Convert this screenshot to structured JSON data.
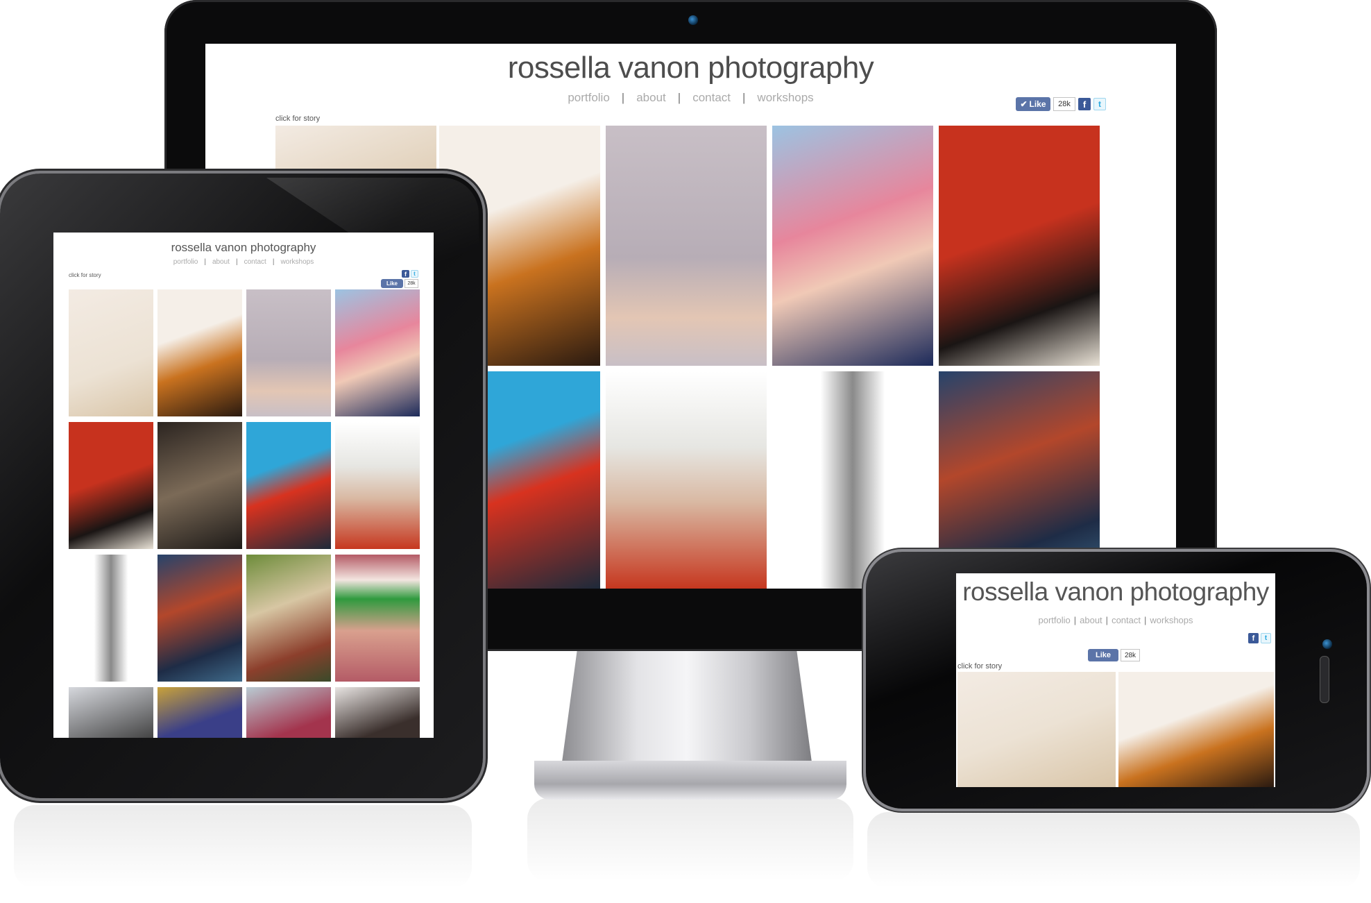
{
  "site": {
    "title": "rossella vanon photography",
    "nav": [
      "portfolio",
      "about",
      "contact",
      "workshops"
    ],
    "separator": "|",
    "click_for_story": "click for story",
    "like_label": "Like",
    "like_count": "28k",
    "facebook_glyph": "f",
    "twitter_glyph": "t"
  },
  "devices": {
    "monitor": {
      "name": "desktop-monitor"
    },
    "tablet": {
      "name": "tablet"
    },
    "phone": {
      "name": "smartphone"
    }
  },
  "photo_tones": {
    "story_blonde": [
      "#f3ebe3",
      "#d9c5a8"
    ],
    "orange_dress": [
      "#f5efe8",
      "#c9721f"
    ],
    "pink_gown": [
      "#c8bfc6",
      "#e3c6b4"
    ],
    "pink_hair": [
      "#9cc3e2",
      "#e7869c"
    ],
    "black_hat": [
      "#c7321e",
      "#1a1514"
    ],
    "red_heart": [
      "#2fa6d8",
      "#d8321f"
    ],
    "floral_head": [
      "#ffffff",
      "#c6371f"
    ],
    "bw_dress": [
      "#ffffff",
      "#8a8a8a"
    ],
    "blue_room": [
      "#26436b",
      "#b3472b"
    ],
    "dark_dress": [
      "#2b2420",
      "#7b6a57"
    ],
    "fur_coat": [
      "#6d8c3a",
      "#8c3f2c"
    ],
    "green_visor": [
      "#b45b66",
      "#2f9a3e"
    ],
    "grey_feather": [
      "#d6d8dd",
      "#3b3b3b"
    ],
    "blue_skin": [
      "#3a3f88",
      "#c9a23a"
    ],
    "pink_sofa": [
      "#b9cbd3",
      "#a3344d"
    ],
    "dark_portrait": [
      "#e8e4e2",
      "#3a2f2c"
    ]
  }
}
